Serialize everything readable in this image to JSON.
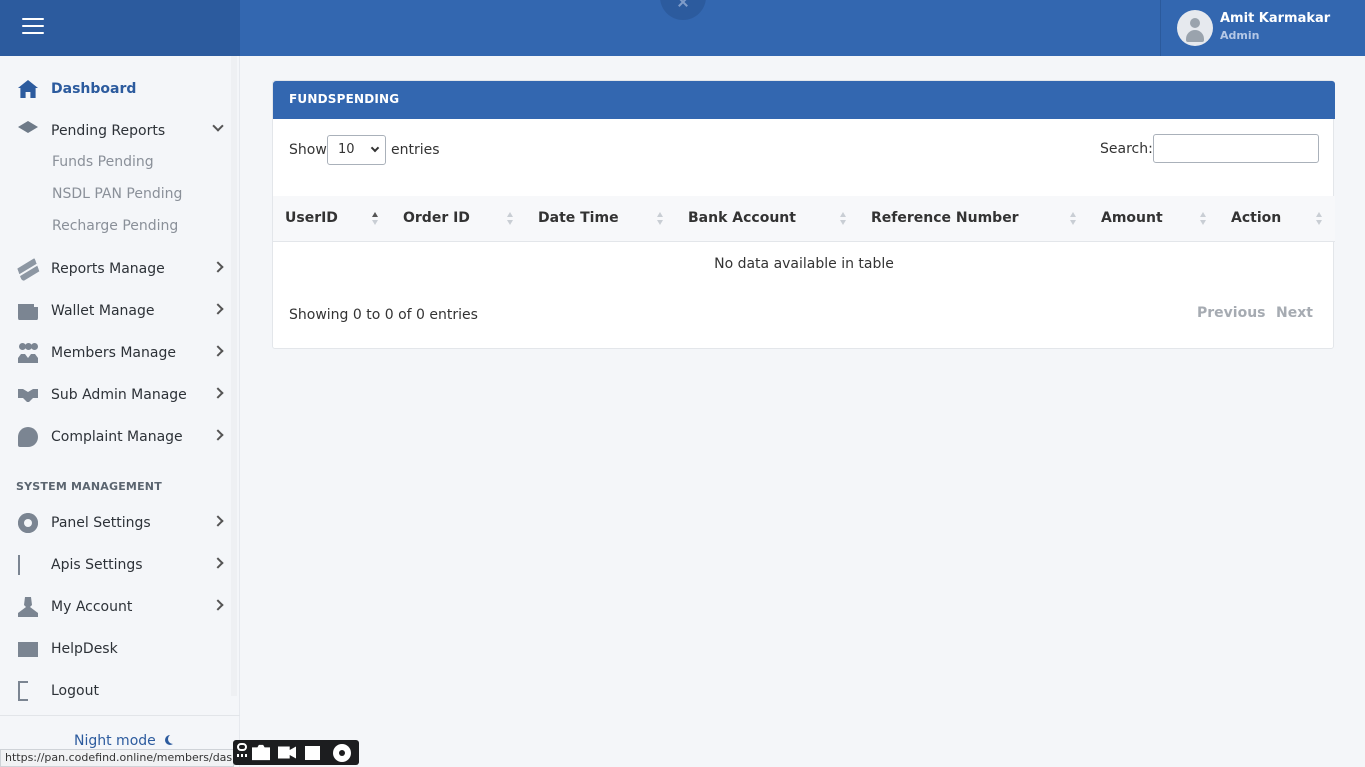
{
  "topbar": {
    "user_name": "Amit Karmakar",
    "user_role": "Admin"
  },
  "sidebar": {
    "dashboard": "Dashboard",
    "pending_reports": "Pending Reports",
    "sub_items": [
      "Funds Pending",
      "NSDL PAN Pending",
      "Recharge Pending"
    ],
    "reports_manage": "Reports Manage",
    "wallet_manage": "Wallet Manage",
    "members_manage": "Members Manage",
    "sub_admin_manage": "Sub Admin Manage",
    "complaint_manage": "Complaint Manage",
    "section_title": "SYSTEM MANAGEMENT",
    "panel_settings": "Panel Settings",
    "apis_settings": "Apis Settings",
    "my_account": "My Account",
    "helpdesk": "HelpDesk",
    "logout": "Logout",
    "night_mode": "Night mode"
  },
  "card": {
    "title": "FUNDSPENDING",
    "show_label": "Show",
    "entries_value": "10",
    "entries_label": "entries",
    "search_label": "Search:",
    "columns": [
      "UserID",
      "Order ID",
      "Date Time",
      "Bank Account",
      "Reference Number",
      "Amount",
      "Action"
    ],
    "empty_message": "No data available in table",
    "info": "Showing 0 to 0 of 0 entries",
    "previous": "Previous",
    "next": "Next"
  },
  "status_url": "https://pan.codefind.online/members/dash",
  "colors": {
    "primary": "#3367b0",
    "primary_dark": "#2c5b9e"
  }
}
